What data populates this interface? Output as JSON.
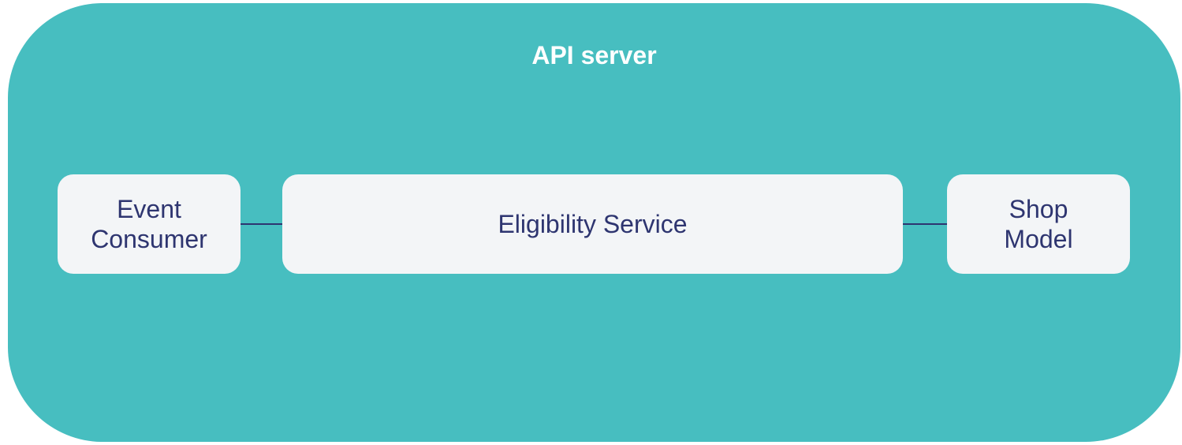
{
  "colors": {
    "server_fill": "#47bec0",
    "box_fill": "#f3f5f7",
    "text": "#2e3570",
    "title_text": "#ffffff"
  },
  "server": {
    "title": "API server"
  },
  "components": {
    "event_consumer": {
      "line1": "Event",
      "line2": "Consumer"
    },
    "eligibility_service": {
      "label": "Eligibility Service"
    },
    "shop_model": {
      "line1": "Shop",
      "line2": "Model"
    }
  }
}
